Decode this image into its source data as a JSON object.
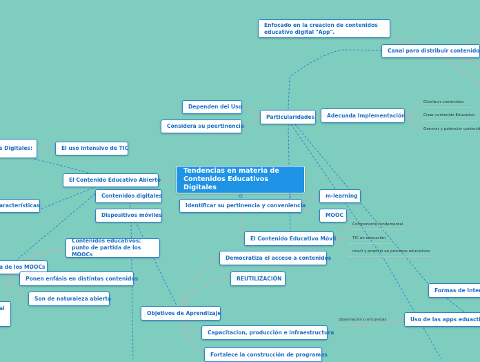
{
  "mindmap": {
    "title": "Tendencias en materia de\nContenidos Educativos Digitales",
    "nodes": {
      "enfocado": "Enfocado en la creacion de contenidos\neducativo digital \"App\".",
      "canal": "Canal para distribuir contenidos",
      "dependen": "Dependen del Uso",
      "particularidades": "Particularidades",
      "considera": "Considera su peertinencia",
      "adecuada": "Adecuada Implementación",
      "digitales_left": "s Digitales:",
      "uso_intensivo": "El uso intensivo de TIC",
      "abierto": "El Contenido Educativo Abierto",
      "contenidos_digitales": "Contenidos digitales",
      "caracteristicas": "aracterísticas",
      "dispositivos": "Dispositivos móviles",
      "identificar": "Identificar su pertinencia y conveniencia",
      "mlearning": "m-learning",
      "mooc": "MOOC",
      "movil": "El Contenido Educativo Móvil",
      "contenidos_educativos": "Contenidos educativos:\npunto de partida de los MOOCs",
      "moocs_left": "a de los MOOCs",
      "ponen_enfasis": "Ponen enfásis en distintos contenidos",
      "naturaleza": "Son de naturaleza abierta",
      "al_left": "al",
      "democratiza": "Democratiza el acceso a contenidos",
      "reutilizacion": "REUTILIZACIÓN",
      "objetivos": "Objetivos de Aprendizaje",
      "capacitacion": "Capacitacion, producción e infraestructura",
      "fortalece": "Fortalece la construcción de programas",
      "formas": "Formas de Intera",
      "uso_apps": "Uso de las apps eduactiva"
    },
    "notes": {
      "distribuir": "Distribuir contenidos",
      "crear": "Crear contenido Educativo",
      "generar": "Generar y potenciar contenido",
      "componente": "Componente fundamental",
      "tic": "TIC en educación",
      "movil_propicio": "movil y propicio en procesos educativos",
      "observacion": "observación o encuestas"
    },
    "colors": {
      "background": "#7ecdbf",
      "node_border": "#2b84d0",
      "node_text": "#1b6ec2",
      "center_fill": "#1f93e6",
      "dashed_link": "#2b84d0",
      "solid_link": "#b9b9b9"
    }
  }
}
